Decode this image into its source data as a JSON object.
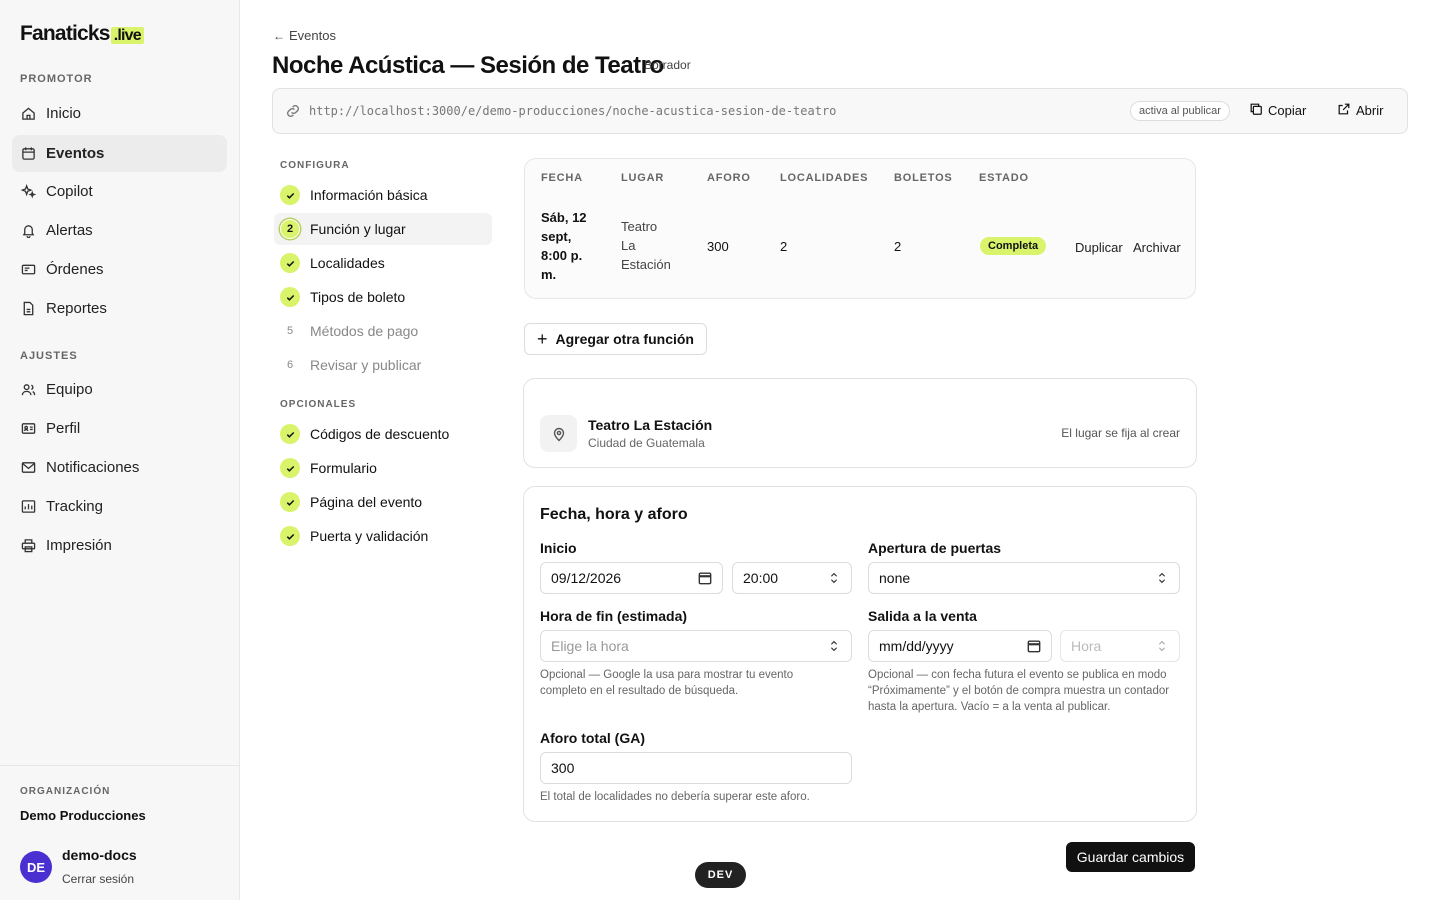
{
  "brand": {
    "logo_main": "Fanaticks",
    "logo_suffix": ".live",
    "accent": "#d9f36b"
  },
  "sidebar": {
    "promoter_label": "PROMOTOR",
    "promoter_items": [
      {
        "label": "Inicio",
        "icon": "home-icon"
      },
      {
        "label": "Eventos",
        "icon": "calendar-icon",
        "active": true
      },
      {
        "label": "Copilot",
        "icon": "sparkle-icon"
      },
      {
        "label": "Alertas",
        "icon": "bell-icon"
      },
      {
        "label": "Órdenes",
        "icon": "ticket-icon"
      },
      {
        "label": "Reportes",
        "icon": "file-icon"
      }
    ],
    "settings_label": "AJUSTES",
    "settings_items": [
      {
        "label": "Equipo",
        "icon": "users-icon"
      },
      {
        "label": "Perfil",
        "icon": "id-card-icon"
      },
      {
        "label": "Notificaciones",
        "icon": "mail-icon"
      },
      {
        "label": "Tracking",
        "icon": "chart-icon"
      },
      {
        "label": "Impresión",
        "icon": "printer-icon"
      }
    ],
    "org_label": "ORGANIZACIÓN",
    "org_name": "Demo Producciones",
    "user_initials": "DE",
    "user_name": "demo-docs",
    "logout_label": "Cerrar sesión"
  },
  "header": {
    "back_label": "Eventos",
    "title": "Noche Acústica — Sesión de Teatro",
    "status": "Borrador",
    "url": "http://localhost:3000/e/demo-producciones/noche-acustica-sesion-de-teatro",
    "url_badge": "activa al publicar",
    "copy_label": "Copiar",
    "open_label": "Abrir"
  },
  "steps": {
    "configure_label": "CONFIGURA",
    "configure": [
      {
        "label": "Información básica",
        "state": "done"
      },
      {
        "label": "Función y lugar",
        "state": "current",
        "num": "2"
      },
      {
        "label": "Localidades",
        "state": "done"
      },
      {
        "label": "Tipos de boleto",
        "state": "done"
      },
      {
        "label": "Métodos de pago",
        "state": "todo",
        "num": "5"
      },
      {
        "label": "Revisar y publicar",
        "state": "todo",
        "num": "6"
      }
    ],
    "optional_label": "OPCIONALES",
    "optional": [
      {
        "label": "Códigos de descuento",
        "state": "done"
      },
      {
        "label": "Formulario",
        "state": "done"
      },
      {
        "label": "Página del evento",
        "state": "done"
      },
      {
        "label": "Puerta y validación",
        "state": "done"
      }
    ]
  },
  "functions_table": {
    "headers": [
      "FECHA",
      "LUGAR",
      "AFORO",
      "LOCALIDADES",
      "BOLETOS",
      "ESTADO"
    ],
    "row": {
      "date_lines": [
        "Sáb, 12",
        "sept,",
        "8:00 p.",
        "m."
      ],
      "venue_lines": [
        "Teatro",
        "La",
        "Estación"
      ],
      "capacity": "300",
      "sections": "2",
      "tickets": "2",
      "status": "Completa",
      "duplicate_label": "Duplicar",
      "archive_label": "Archivar"
    }
  },
  "add_function_label": "Agregar otra función",
  "venue": {
    "name": "Teatro La Estación",
    "city": "Ciudad de Guatemala",
    "note": "El lugar se fija al crear"
  },
  "form": {
    "title": "Fecha, hora y aforo",
    "start_label": "Inicio",
    "start_date": "09/12/2026",
    "start_time": "20:00",
    "doors_label": "Apertura de puertas",
    "doors_value": "none",
    "end_label": "Hora de fin (estimada)",
    "end_placeholder": "Elige la hora",
    "end_help": "Opcional — Google la usa para mostrar tu evento completo en el resultado de búsqueda.",
    "sale_label": "Salida a la venta",
    "sale_date_placeholder": "mm/dd/yyyy",
    "sale_time_placeholder": "Hora",
    "sale_help": "Opcional — con fecha futura el evento se publica en modo “Próximamente” y el botón de compra muestra un contador hasta la apertura. Vacío = a la venta al publicar.",
    "capacity_label": "Aforo total (GA)",
    "capacity_value": "300",
    "capacity_help": "El total de localidades no debería superar este aforo."
  },
  "save_label": "Guardar cambios",
  "dev_label": "DEV"
}
